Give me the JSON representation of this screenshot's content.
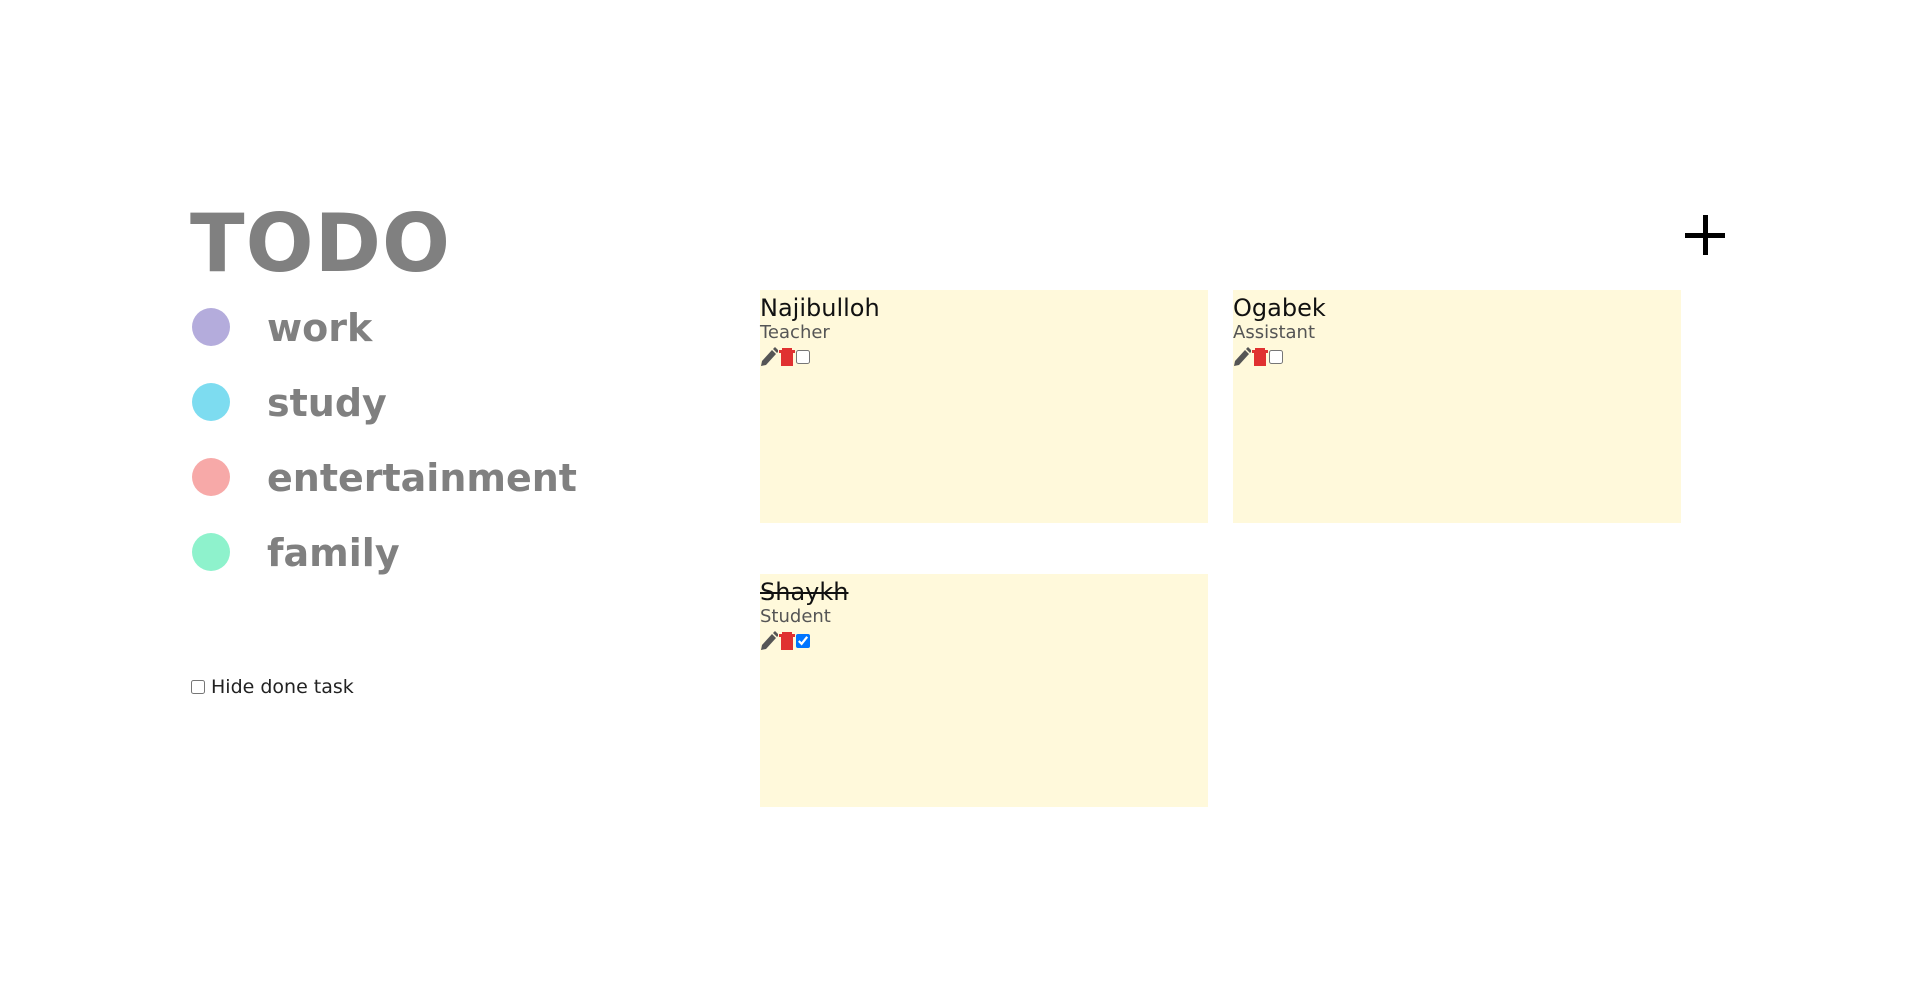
{
  "app": {
    "title": "TODO",
    "add_button_label": "+"
  },
  "categories": [
    {
      "label": "work",
      "color": "#b4acdc"
    },
    {
      "label": "study",
      "color": "#7ddcf0"
    },
    {
      "label": "entertainment",
      "color": "#f7a9a8"
    },
    {
      "label": "family",
      "color": "#8ef2cc"
    }
  ],
  "filters": {
    "hide_done_label": "Hide done task",
    "hide_done_checked": false
  },
  "tasks": [
    {
      "name": "Najibulloh",
      "role": "Teacher",
      "done": false
    },
    {
      "name": "Ogabek",
      "role": "Assistant",
      "done": false
    },
    {
      "name": "Shaykh",
      "role": "Student",
      "done": true
    }
  ],
  "icons": {
    "edit": "pencil-icon",
    "delete": "trash-icon"
  },
  "colors": {
    "card_background": "#fff9db",
    "title_gray": "#808080",
    "delete_red": "#e03131",
    "edit_gray": "#555555"
  }
}
